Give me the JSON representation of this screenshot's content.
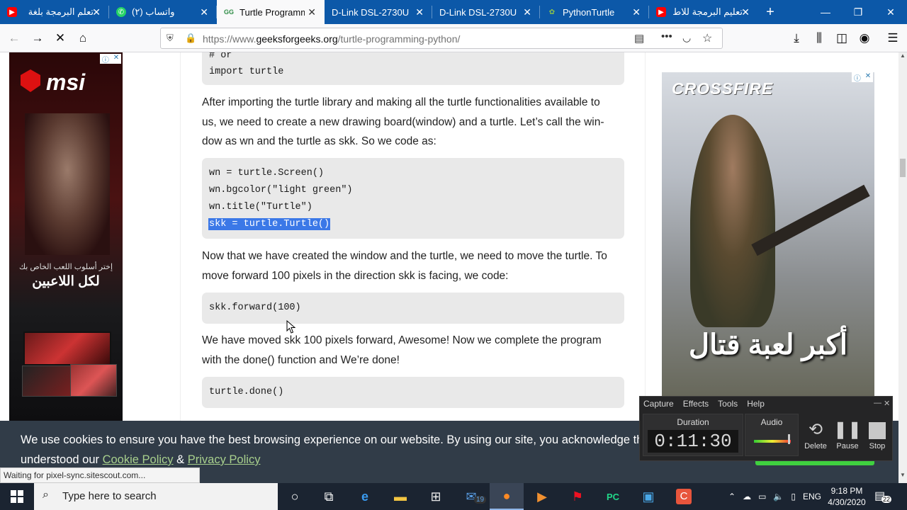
{
  "tabs": [
    {
      "label": "تعلم البرمجة بلغة",
      "icon": "youtube-icon",
      "color": "#ff0000"
    },
    {
      "label": "(٢) واتساب",
      "icon": "whatsapp-icon",
      "color": "#25d366"
    },
    {
      "label": "Turtle Programmi",
      "icon": "geeksforgeeks-icon",
      "color": "#2f8d46"
    },
    {
      "label": "D-Link DSL-2730U",
      "icon": "",
      "color": ""
    },
    {
      "label": "D-Link DSL-2730U",
      "icon": "",
      "color": ""
    },
    {
      "label": "PythonTurtle",
      "icon": "turtle-icon",
      "color": "#6b8e23"
    },
    {
      "label": "تعليم البرمجة للاط",
      "icon": "youtube-icon",
      "color": "#ff0000"
    }
  ],
  "url": {
    "prefix": "https://www.",
    "domain": "geeksforgeeks.org",
    "path": "/turtle-programming-python/"
  },
  "article": {
    "code1": [
      "# or",
      "import turtle"
    ],
    "para1": "After importing the turtle library and making all the turtle functionalities available to us, we need to create a new drawing board(window) and a turtle. Let’s call the win-dow as wn and the turtle as skk. So we code as:",
    "para1_lines": [
      "After importing the turtle library and making all the turtle functionalities available to",
      "us, we need to create a new drawing board(window) and a turtle. Let’s call the win-",
      "dow as wn and the turtle as skk. So we code as:"
    ],
    "code2": [
      "wn = turtle.Screen()",
      "wn.bgcolor(\"light green\")",
      "wn.title(\"Turtle\")",
      "skk = turtle.Turtle()"
    ],
    "para2_lines": [
      "Now that we have created the window and the turtle, we need to move the turtle. To",
      "move forward 100 pixels in the direction skk is facing, we code:"
    ],
    "code3": [
      "skk.forward(100)"
    ],
    "para3_lines": [
      "We have moved skk 100 pixels forward, Awesome! Now we complete the program",
      "with the done() function and We’re done!"
    ],
    "code4": [
      "turtle.done()"
    ]
  },
  "ads": {
    "left_brand": "msi",
    "left_tagline_1": "إختر أسلوب اللعب الخاص بك",
    "left_tagline_2": "لكل اللاعبين",
    "right_brand": "CROSSFIRE",
    "right_tagline": "أكبر لعبة قتال"
  },
  "cookie": {
    "line1": "We use cookies to ensure you have the best browsing experience on our website. By using our site, you acknowledge that y",
    "line2_prefix": "understood our ",
    "cookie_policy": "Cookie Policy",
    "amp": " & ",
    "privacy_policy": "Privacy Policy"
  },
  "status_text": "Waiting for pixel-sync.sitescout.com...",
  "recorder": {
    "menu": [
      "Capture",
      "Effects",
      "Tools",
      "Help"
    ],
    "duration_label": "Duration",
    "duration": "0:11:30",
    "audio_label": "Audio",
    "delete": "Delete",
    "pause": "Pause",
    "stop": "Stop"
  },
  "taskbar": {
    "search_placeholder": "Type here to search",
    "mail_badge": "19",
    "lang": "ENG",
    "time": "9:18 PM",
    "date": "4/30/2020",
    "notif_count": "22"
  }
}
